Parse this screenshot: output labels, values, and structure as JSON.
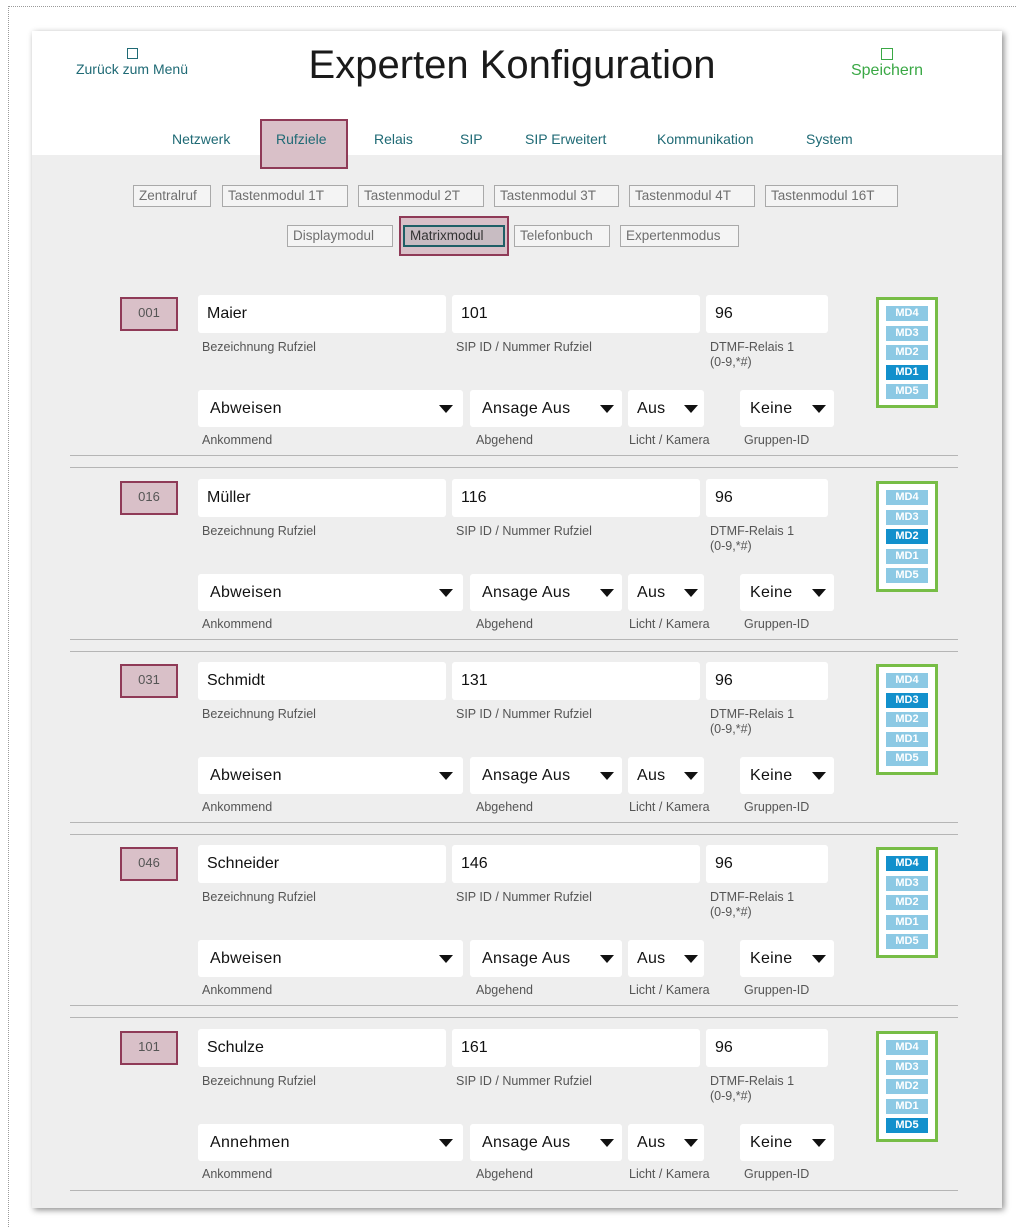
{
  "header": {
    "back_label": "Zurück zum Menü",
    "title": "Experten Konfiguration",
    "save_label": "Speichern"
  },
  "main_tabs": [
    "Netzwerk",
    "Rufziele",
    "Relais",
    "SIP",
    "SIP Erweitert",
    "Kommunikation",
    "System"
  ],
  "main_tab_active": "Rufziele",
  "sub_tabs": [
    "Zentralruf",
    "Tastenmodul 1T",
    "Tastenmodul 2T",
    "Tastenmodul 3T",
    "Tastenmodul 4T",
    "Tastenmodul 16T",
    "Displaymodul",
    "Matrixmodul",
    "Telefonbuch",
    "Expertenmodus"
  ],
  "sub_tab_active": "Matrixmodul",
  "labels": {
    "name": "Bezeichnung Rufziel",
    "sip": "SIP ID / Nummer Rufziel",
    "dtmf": "DTMF-Relais 1",
    "dtmf_hint": "(0-9,*#)",
    "incoming": "Ankommend",
    "outgoing": "Abgehend",
    "light": "Licht / Kamera",
    "group": "Gruppen-ID"
  },
  "md_buttons": [
    "MD4",
    "MD3",
    "MD2",
    "MD1",
    "MD5"
  ],
  "entries": [
    {
      "id": "001",
      "name": "Maier",
      "sip": "101",
      "dtmf": "96",
      "incoming": "Abweisen",
      "outgoing": "Ansage Aus",
      "light": "Aus",
      "group": "Keine",
      "md_active": "MD1"
    },
    {
      "id": "016",
      "name": "Müller",
      "sip": "116",
      "dtmf": "96",
      "incoming": "Abweisen",
      "outgoing": "Ansage Aus",
      "light": "Aus",
      "group": "Keine",
      "md_active": "MD2"
    },
    {
      "id": "031",
      "name": "Schmidt",
      "sip": "131",
      "dtmf": "96",
      "incoming": "Abweisen",
      "outgoing": "Ansage Aus",
      "light": "Aus",
      "group": "Keine",
      "md_active": "MD3"
    },
    {
      "id": "046",
      "name": "Schneider",
      "sip": "146",
      "dtmf": "96",
      "incoming": "Abweisen",
      "outgoing": "Ansage Aus",
      "light": "Aus",
      "group": "Keine",
      "md_active": "MD4"
    },
    {
      "id": "101",
      "name": "Schulze",
      "sip": "161",
      "dtmf": "96",
      "incoming": "Annehmen",
      "outgoing": "Ansage Aus",
      "light": "Aus",
      "group": "Keine",
      "md_active": "MD5"
    }
  ],
  "colors": {
    "accent_teal": "#1f6a75",
    "save_green": "#3aa845",
    "active_tab_fill": "#d9c0c8",
    "active_tab_border": "#8f3a57",
    "md_inactive": "#8cc9e4",
    "md_active": "#1290cc",
    "md_frame": "#77bd46"
  }
}
